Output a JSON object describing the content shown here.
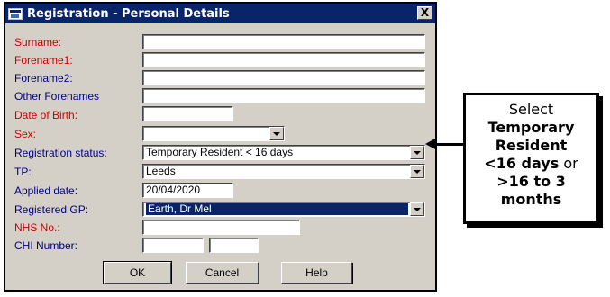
{
  "window": {
    "title": "Registration - Personal Details",
    "close_label": "X"
  },
  "labels": {
    "surname": "Surname:",
    "forename1": "Forename1:",
    "forename2": "Forename2:",
    "other_forenames": "Other Forenames",
    "dob": "Date of Birth:",
    "sex": "Sex:",
    "reg_status": "Registration status:",
    "tp": "TP:",
    "applied_date": "Applied date:",
    "registered_gp": "Registered GP:",
    "nhs_no": "NHS No.:",
    "chi_number": "CHI Number:"
  },
  "values": {
    "surname": "",
    "forename1": "",
    "forename2": "",
    "other_forenames": "",
    "dob": "",
    "sex": "",
    "reg_status": "Temporary Resident < 16 days",
    "tp": "Leeds",
    "applied_date": "20/04/2020",
    "registered_gp": "Earth, Dr Mel",
    "nhs_no": "",
    "chi_1": "",
    "chi_2": ""
  },
  "buttons": {
    "ok": "OK",
    "cancel": "Cancel",
    "help": "Help"
  },
  "callout": {
    "line1": "Select",
    "line2": "Temporary",
    "line3": "Resident",
    "line4_bold": "<16 days",
    "line4_rest": " or",
    "line5": ">16 to 3",
    "line6": "months"
  },
  "colors": {
    "title_bar": "#0a246a",
    "dialog_bg": "#d4d0c8",
    "required_label": "#cc0000",
    "optional_label": "#000080"
  }
}
